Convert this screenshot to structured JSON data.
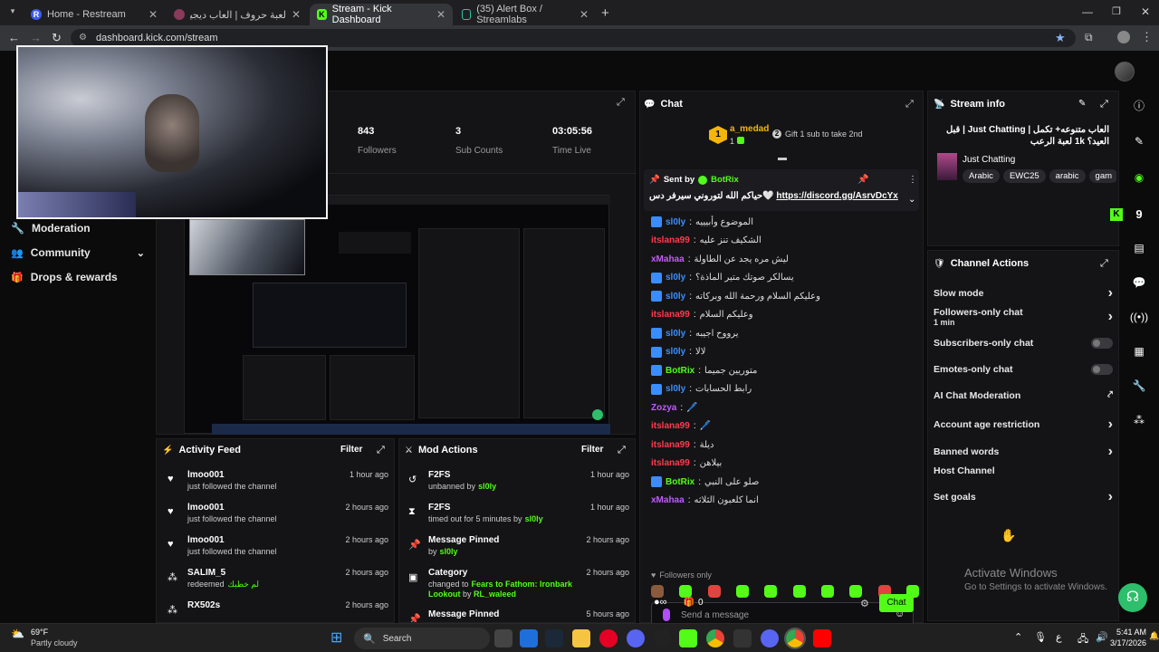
{
  "browser": {
    "tabs": [
      {
        "label": "Home - Restream",
        "icon": "restream-icon",
        "color": "#3b5cf6",
        "glyph": "R"
      },
      {
        "label": "لعبة حروف | العاب ديجيز - لعبة ت",
        "icon": "profile-icon",
        "color": "#8a3a5a",
        "glyph": ""
      },
      {
        "label": "Stream - Kick Dashboard",
        "icon": "kick-icon",
        "color": "#53fc18",
        "glyph": "K"
      },
      {
        "label": "(35) Alert Box / Streamlabs",
        "icon": "streamlabs-icon",
        "color": "#31c3a2",
        "glyph": ""
      }
    ],
    "url": "dashboard.kick.com/stream"
  },
  "sidebar": {
    "items": [
      {
        "label": "Moderation",
        "icon": "wrench-icon"
      },
      {
        "label": "Community",
        "icon": "community-icon"
      },
      {
        "label": "Drops & rewards",
        "icon": "drops-icon"
      }
    ]
  },
  "stats": {
    "followers": {
      "value": "843",
      "label": "Followers"
    },
    "subs": {
      "value": "3",
      "label": "Sub Counts"
    },
    "time": {
      "value": "03:05:56",
      "label": "Time Live"
    }
  },
  "chat": {
    "title": "Chat",
    "top_gifter": {
      "name": "a_medad",
      "count": "1",
      "rank": "1"
    },
    "gift_text": "Gift 1 sub to take 2nd",
    "pinned": {
      "label": "Sent by",
      "author": "BotRix",
      "text": "حياكم الله لتوروني سيرفر دس🤍",
      "link": "https://discord.gg/AsrvDcYx"
    },
    "messages": [
      {
        "user": "sl0ly",
        "color": "#3a8dff",
        "text": "الموضوع وأبيييه"
      },
      {
        "user": "itslana99",
        "color": "#ff3b4e",
        "text": "الشكيف تنز عليه"
      },
      {
        "user": "xMahaa",
        "color": "#c05bff",
        "text": "ليش مره يجد عن الطاولة"
      },
      {
        "user": "sl0ly",
        "color": "#3a8dff",
        "text": "يسالكر صوتك متير الماذة؟"
      },
      {
        "user": "sl0ly",
        "color": "#3a8dff",
        "text": "وعليكم السلام ورحمة الله وبركاته"
      },
      {
        "user": "itslana99",
        "color": "#ff3b4e",
        "text": "وعليكم السلام"
      },
      {
        "user": "sl0ly",
        "color": "#3a8dff",
        "text": "يرووح اجيبه"
      },
      {
        "user": "sl0ly",
        "color": "#3a8dff",
        "text": "لالا"
      },
      {
        "user": "BotRix",
        "color": "#53fc18",
        "text": "متوريين جميما"
      },
      {
        "user": "sl0ly",
        "color": "#3a8dff",
        "text": "رابط الحسابات"
      },
      {
        "user": "Zozya",
        "color": "#c05bff",
        "text": "🖊️"
      },
      {
        "user": "itslana99",
        "color": "#ff3b4e",
        "text": "🖊️"
      },
      {
        "user": "itslana99",
        "color": "#ff3b4e",
        "text": "ديلة"
      },
      {
        "user": "itslana99",
        "color": "#ff3b4e",
        "text": "بيلاهن"
      },
      {
        "user": "BotRix",
        "color": "#53fc18",
        "text": "صلو على النبي"
      },
      {
        "user": "xMahaa",
        "color": "#c05bff",
        "text": "انما كلعبون الثلاثه"
      }
    ],
    "followers_only": "Followers only",
    "placeholder": "Send a message",
    "points": "0",
    "send_label": "Chat"
  },
  "stream_info": {
    "title": "Stream info",
    "stream_title": "العاب متنوعه+ تكمل | Just Chatting | قبل العيد؟ 1k لعبة الرعب",
    "category": "Just Chatting",
    "tags": [
      "Arabic",
      "EWC25",
      "arabic",
      "gam"
    ]
  },
  "channel_actions": {
    "title": "Channel Actions",
    "items": [
      {
        "label": "Slow mode",
        "control": "chevron"
      },
      {
        "label": "Followers-only chat",
        "sub": "1 min",
        "control": "chevron"
      },
      {
        "label": "Subscribers-only chat",
        "control": "toggle"
      },
      {
        "label": "Emotes-only chat",
        "control": "toggle"
      },
      {
        "label": "AI Chat Moderation",
        "control": "external"
      },
      {
        "label": "Account age restriction",
        "control": "chevron"
      },
      {
        "label": "Banned words",
        "control": "chevron"
      },
      {
        "label": "Host Channel",
        "control": "none"
      },
      {
        "label": "Set goals",
        "control": "chevron"
      }
    ]
  },
  "activity": {
    "title": "Activity Feed",
    "filter": "Filter",
    "items": [
      {
        "user": "lmoo001",
        "desc": "just followed the channel",
        "time": "1 hour ago",
        "icon": "heart-icon"
      },
      {
        "user": "lmoo001",
        "desc": "just followed the channel",
        "time": "2 hours ago",
        "icon": "heart-icon"
      },
      {
        "user": "lmoo001",
        "desc": "just followed the channel",
        "time": "2 hours ago",
        "icon": "heart-icon"
      },
      {
        "user": "SALIM_5",
        "desc": "redeemed",
        "extra": "لم خطبك",
        "time": "2 hours ago",
        "icon": "reward-icon"
      },
      {
        "user": "RX502s",
        "desc": "",
        "time": "2 hours ago",
        "icon": "reward-icon"
      }
    ]
  },
  "mod_actions": {
    "title": "Mod Actions",
    "filter": "Filter",
    "items": [
      {
        "title": "F2FS",
        "desc": "unbanned by",
        "by": "sl0ly",
        "time": "1 hour ago",
        "icon": "undo-icon"
      },
      {
        "title": "F2FS",
        "desc": "timed out for 5 minutes by",
        "by": "sl0ly",
        "time": "1 hour ago",
        "icon": "hourglass-icon"
      },
      {
        "title": "Message Pinned",
        "desc": "by",
        "by": "sl0ly",
        "time": "2 hours ago",
        "icon": "pin-icon"
      },
      {
        "title": "Category",
        "desc": "changed to",
        "by": "Fears to Fathom: Ironbark Lookout",
        "by2": "RL_waleed",
        "time": "2 hours ago",
        "icon": "category-icon"
      },
      {
        "title": "Message Pinned",
        "desc": "",
        "by": "",
        "time": "5 hours ago",
        "icon": "pin-icon"
      }
    ]
  },
  "right_rail": {
    "kick_count": "9"
  },
  "watermark": {
    "line1": "Activate Windows",
    "line2": "Go to Settings to activate Windows."
  },
  "taskbar": {
    "weather_temp": "69°F",
    "weather_desc": "Partly cloudy",
    "search": "Search",
    "time": "5:41 AM",
    "date": "3/17/2026"
  }
}
